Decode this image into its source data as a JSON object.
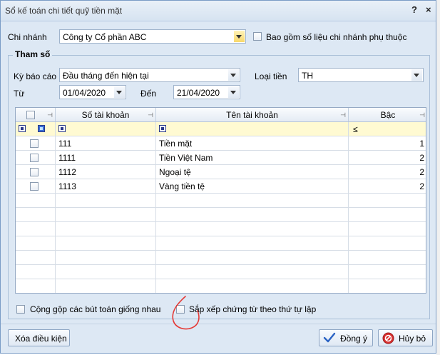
{
  "dialog": {
    "title": "Sổ kế toán chi tiết quỹ tiền mặt",
    "help_label": "?",
    "close_label": "×"
  },
  "branch": {
    "label": "Chi nhánh",
    "value": "Công ty Cổ phần ABC",
    "include_dependent_label": "Bao gồm số liệu chi nhánh phụ thuộc",
    "include_dependent_checked": false
  },
  "params": {
    "group_title": "Tham số",
    "period_label": "Kỳ báo cáo",
    "period_value": "Đầu tháng đến hiện tại",
    "currency_label": "Loại tiền",
    "currency_value": "TH",
    "from_label": "Từ",
    "from_value": "01/04/2020",
    "to_label": "Đến",
    "to_value": "21/04/2020"
  },
  "grid": {
    "columns": [
      "Số tài khoản",
      "Tên tài khoản",
      "Bậc"
    ],
    "filter_level_op": "≤",
    "rows": [
      {
        "account": "111",
        "name": "Tiền mặt",
        "level": "1",
        "checked": false
      },
      {
        "account": "1111",
        "name": "Tiền Việt Nam",
        "level": "2",
        "checked": false
      },
      {
        "account": "1112",
        "name": "Ngoại tệ",
        "level": "2",
        "checked": false
      },
      {
        "account": "1113",
        "name": "Vàng tiền tệ",
        "level": "2",
        "checked": false
      }
    ]
  },
  "options": {
    "merge_label": "Cộng gộp các bút toán giống nhau",
    "sort_label": "Sắp xếp chứng từ theo thứ tự lập"
  },
  "buttons": {
    "clear_label": "Xóa điều kiện",
    "ok_label": "Đồng ý",
    "cancel_label": "Hủy bỏ"
  },
  "icons": {
    "ok": "checkmark-icon",
    "cancel": "cancel-circle-icon",
    "annotation": "red-hand-drawn-mark"
  },
  "colors": {
    "dialog_bg": "#dde8f4",
    "filter_row": "#fffad2",
    "annotation": "#e53935"
  }
}
